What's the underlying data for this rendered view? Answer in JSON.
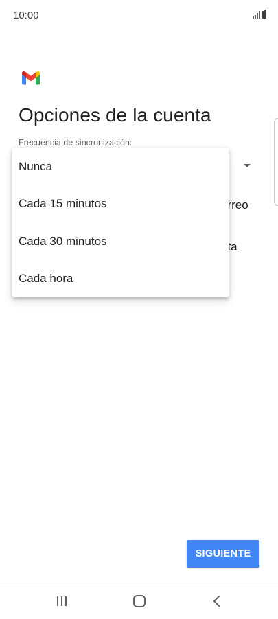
{
  "status_bar": {
    "time": "10:00"
  },
  "header": {
    "logo": "gmail-logo",
    "title": "Opciones de la cuenta"
  },
  "form": {
    "sync_frequency_label": "Frecuencia de sincronización:",
    "behind_text_1": "orreo",
    "behind_text_2": "nta"
  },
  "dropdown": {
    "options": [
      {
        "label": "Nunca"
      },
      {
        "label": "Cada 15 minutos"
      },
      {
        "label": "Cada 30 minutos"
      },
      {
        "label": "Cada hora"
      }
    ]
  },
  "footer": {
    "next_label": "SIGUIENTE"
  },
  "navigation": {
    "icons": [
      "recents-icon",
      "home-icon",
      "back-icon"
    ]
  },
  "colors": {
    "primary_button": "#4285f4",
    "text_primary": "#202124",
    "text_secondary": "#5f6368"
  }
}
